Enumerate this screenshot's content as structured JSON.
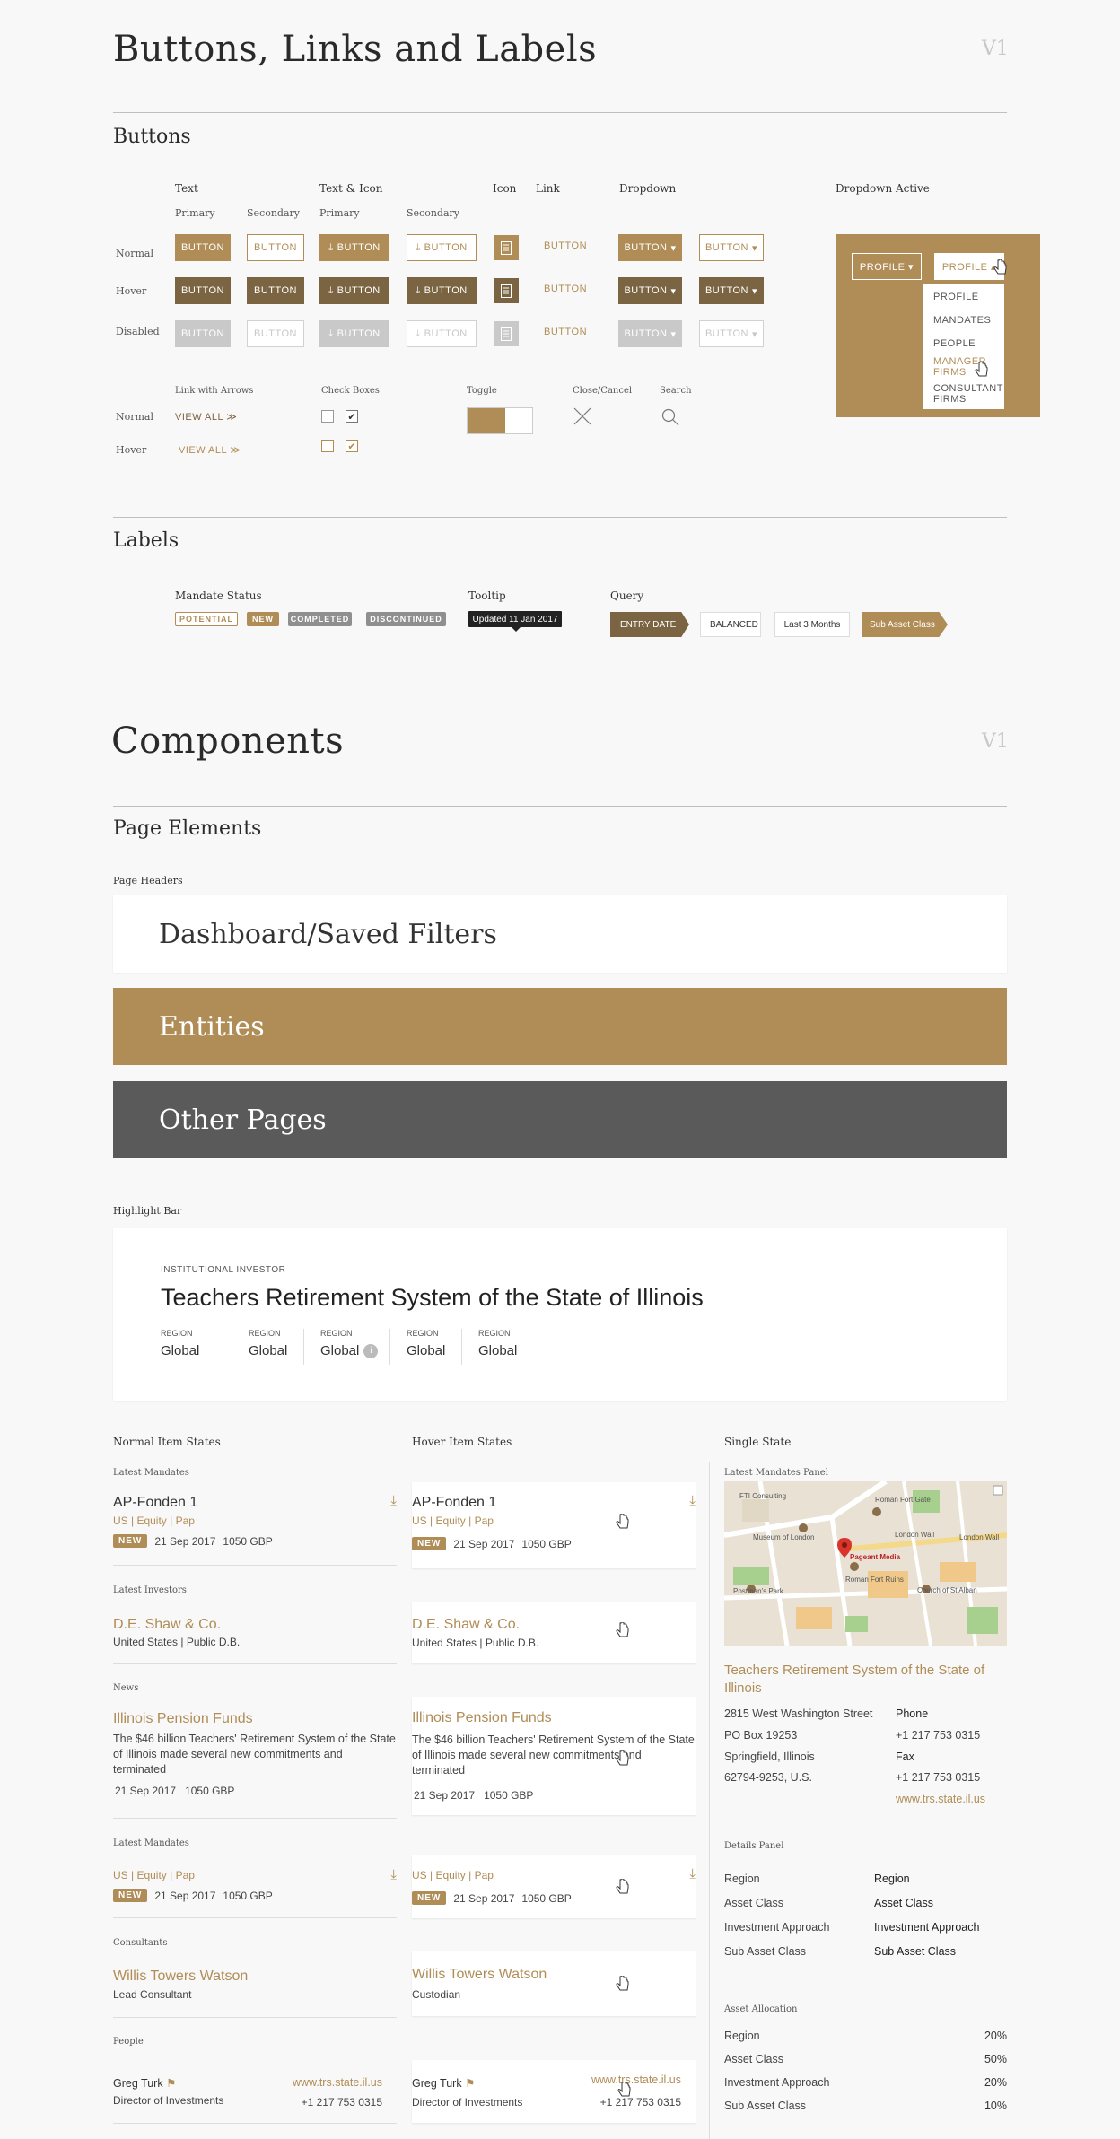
{
  "section1": {
    "title": "Buttons, Links and Labels",
    "version": "V1"
  },
  "buttons": {
    "title": "Buttons",
    "col_text": "Text",
    "col_text_icon": "Text & Icon",
    "col_icon": "Icon",
    "col_link": "Link",
    "col_dropdown": "Dropdown",
    "col_dropdown_active": "Dropdown Active",
    "sub_primary": "Primary",
    "sub_secondary": "Secondary",
    "row_normal": "Normal",
    "row_hover": "Hover",
    "row_disabled": "Disabled",
    "label": "BUTTON",
    "caret": "▾",
    "dropdown_active": {
      "label_primary": "PROFILE ▾",
      "label_open": "PROFILE ▴",
      "items": [
        "PROFILE",
        "MANDATES",
        "PEOPLE",
        "MANAGER FIRMS",
        "CONSULTANT FIRMS"
      ]
    }
  },
  "links": {
    "col_arrows": "Link with Arrows",
    "col_checkboxes": "Check Boxes",
    "col_toggle": "Toggle",
    "col_close": "Close/Cancel",
    "col_search": "Search",
    "row_normal": "Normal",
    "row_hover": "Hover",
    "view_all": "VIEW ALL",
    "arrows": "≫"
  },
  "labels": {
    "title": "Labels",
    "col_mandate": "Mandate Status",
    "col_tooltip": "Tooltip",
    "col_query": "Query",
    "mandate": [
      "POTENTIAL",
      "NEW",
      "COMPLETED",
      "DISCONTINUED"
    ],
    "tooltip": "Updated 11 Jan 2017",
    "query": [
      "ENTRY DATE",
      "BALANCED",
      "Last 3 Months",
      "Sub Asset Class"
    ]
  },
  "section2": {
    "title": "Components",
    "version": "V1"
  },
  "page_elements": {
    "title": "Page Elements",
    "headers_label": "Page Headers",
    "headers": [
      "Dashboard/Saved Filters",
      "Entities",
      "Other Pages"
    ],
    "highlight_label": "Highlight Bar",
    "highlight": {
      "eyebrow": "INSTITUTIONAL INVESTOR",
      "name": "Teachers Retirement System of the State of Illinois",
      "stat_label": "REGION",
      "stat_value": "Global",
      "info": "i"
    }
  },
  "items": {
    "col_normal": "Normal Item States",
    "col_hover": "Hover Item States",
    "col_single": "Single State",
    "latest_mandates": "Latest Mandates",
    "mandate_name": "AP-Fonden 1",
    "mandate_path": "US | Equity | Pap",
    "new": "NEW",
    "date": "21 Sep 2017",
    "amount": "1050 GBP",
    "latest_investors": "Latest Investors",
    "investor_name": "D.E. Shaw & Co.",
    "investor_meta": "United States | Public D.B.",
    "news": "News",
    "news_title": "Illinois Pension Funds",
    "news_body": "The $46 billion Teachers' Retirement System of the State of Illinois made several new commitments and terminated",
    "consultants": "Consultants",
    "consultant_name": "Willis Towers Watson",
    "consultant_role_normal": "Lead Consultant",
    "consultant_role_hover": "Custodian",
    "people": "People",
    "person_name": "Greg Turk",
    "person_title": "Director of Investments",
    "person_web": "www.trs.state.il.us",
    "person_phone": "+1 217 753 0315"
  },
  "single": {
    "panel_label": "Latest Mandates Panel",
    "map": {
      "pin": "Pageant Media",
      "labels": [
        "FTI Consulting",
        "Roman Fort Gate",
        "Museum of London",
        "London Wall",
        "London Wall",
        "Postman's Park",
        "Roman Fort Ruins",
        "Church of St Alban"
      ]
    },
    "org_name": "Teachers Retirement System of the State of Illinois",
    "address": [
      "2815 West Washington Street",
      "PO Box 19253",
      "Springfield, Illinois",
      "62794-9253, U.S."
    ],
    "phone_label": "Phone",
    "phone": "+1 217 753 0315",
    "fax_label": "Fax",
    "fax": "+1 217 753 0315",
    "web": "www.trs.state.il.us",
    "details_label": "Details Panel",
    "details": [
      [
        "Region",
        "Region"
      ],
      [
        "Asset Class",
        "Asset Class"
      ],
      [
        "Investment Approach",
        "Investment Approach"
      ],
      [
        "Sub Asset Class",
        "Sub Asset Class"
      ]
    ],
    "allocation_label": "Asset Allocation",
    "allocation": [
      [
        "Region",
        "20%"
      ],
      [
        "Asset Class",
        "50%"
      ],
      [
        "Investment Approach",
        "20%"
      ],
      [
        "Sub Asset Class",
        "10%"
      ]
    ]
  },
  "colors": {
    "gold": "#b08d57",
    "gold_dark": "#7a6441",
    "dark": "#5a5a5a",
    "disabled": "#c9c9c9"
  }
}
